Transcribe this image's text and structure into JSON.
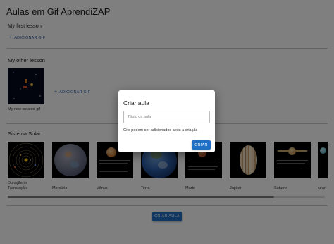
{
  "app": {
    "title": "Aulas em Gif AprendiZAP"
  },
  "lessons": [
    {
      "title": "My first lesson",
      "add_label": "ADICIONAR GIF",
      "gifs": []
    },
    {
      "title": "My other lesson",
      "add_label": "ADICIONAR GIF",
      "gifs": [
        {
          "caption": "My new created gif",
          "icon": "space-scene-thumbnail"
        }
      ]
    },
    {
      "title": "Sistema Solar",
      "gifs": [
        {
          "caption": "Duração de Translação",
          "icon": "solar-system-orbits-thumbnail"
        },
        {
          "caption": "Mercúrio",
          "icon": "mercury-thumbnail"
        },
        {
          "caption": "Vênus",
          "icon": "venus-thumbnail"
        },
        {
          "caption": "Terra",
          "icon": "earth-thumbnail"
        },
        {
          "caption": "Marte",
          "icon": "mars-thumbnail"
        },
        {
          "caption": "Júpiter",
          "icon": "jupiter-thumbnail"
        },
        {
          "caption": "Saturno",
          "icon": "saturn-thumbnail"
        },
        {
          "caption": "urar",
          "icon": "uranus-thumbnail"
        }
      ]
    }
  ],
  "create_lesson_button": "CRIAR AULA",
  "dialog": {
    "title": "Criar aula",
    "input_placeholder": "Título da aula",
    "input_value": "",
    "note": "Gifs podem ser adicionados após a criação",
    "create_button": "CRIAR"
  },
  "colors": {
    "accent": "#1f6fc5",
    "overlay": "rgba(0,0,0,0.5)",
    "link": "#2f5fa8"
  }
}
